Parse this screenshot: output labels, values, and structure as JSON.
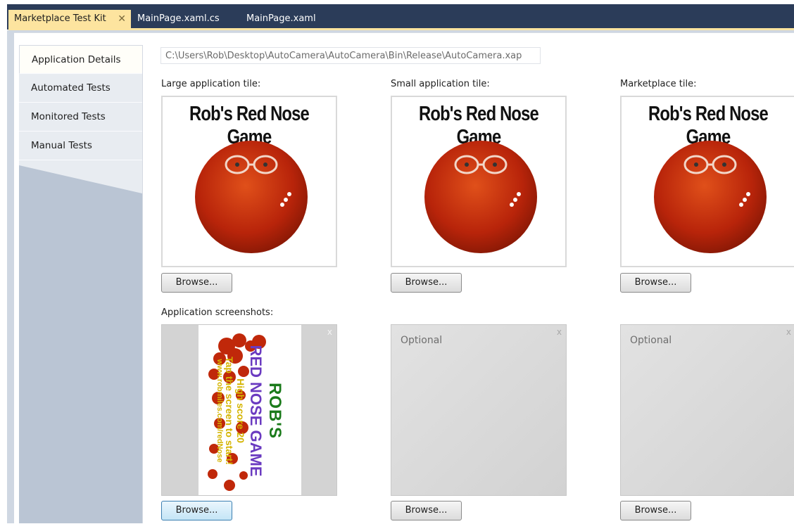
{
  "tabs": [
    {
      "label": "Marketplace Test Kit",
      "active": true,
      "close": "✕"
    },
    {
      "label": "MainPage.xaml.cs",
      "active": false
    },
    {
      "label": "MainPage.xaml",
      "active": false
    }
  ],
  "sidebar": {
    "items": [
      {
        "label": "Application Details",
        "active": true
      },
      {
        "label": "Automated Tests",
        "active": false
      },
      {
        "label": "Monitored Tests",
        "active": false
      },
      {
        "label": "Manual Tests",
        "active": false
      }
    ]
  },
  "details": {
    "xap_path": "C:\\Users\\Rob\\Desktop\\AutoCamera\\AutoCamera\\Bin\\Release\\AutoCamera.xap",
    "tiles": [
      {
        "label": "Large application tile:",
        "title": "Rob's Red Nose Game",
        "browse": "Browse..."
      },
      {
        "label": "Small application tile:",
        "title": "Rob's Red Nose Game",
        "browse": "Browse..."
      },
      {
        "label": "Marketplace tile:",
        "title": "Rob's Red Nose Game",
        "browse": "Browse..."
      }
    ],
    "screenshots_label": "Application screenshots:",
    "screenshots": [
      {
        "filled": true,
        "remove": "x",
        "browse": "Browse...",
        "text_lines": [
          "ROB'S",
          "RED NOSE GAME",
          "High score 20",
          "Tap the screen to start!",
          "www.robmiles.com/redNose"
        ]
      },
      {
        "filled": false,
        "placeholder": "Optional",
        "remove": "x",
        "browse": "Browse..."
      },
      {
        "filled": false,
        "placeholder": "Optional",
        "remove": "x",
        "browse": "Browse..."
      }
    ]
  },
  "colors": {
    "tab_bar": "#2b3c59",
    "active_tab": "#fde49f",
    "sidebar": "#bac5d4",
    "tomato_red": "#c0280a"
  }
}
